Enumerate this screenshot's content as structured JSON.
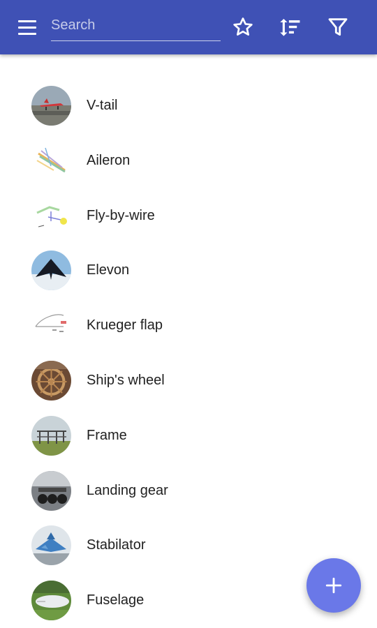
{
  "app_bar": {
    "background_color": "#3f51b5",
    "menu_icon": "hamburger-menu-icon",
    "search": {
      "placeholder": "Search",
      "value": ""
    },
    "actions": [
      {
        "icon": "star-outline-icon"
      },
      {
        "icon": "sort-icon"
      },
      {
        "icon": "filter-icon"
      }
    ]
  },
  "list": {
    "items": [
      {
        "label": "V-tail",
        "thumbnail": "red-aircraft-on-runway"
      },
      {
        "label": "Aileron",
        "thumbnail": "aileron-diagram"
      },
      {
        "label": "Fly-by-wire",
        "thumbnail": "fly-by-wire-diagram"
      },
      {
        "label": "Elevon",
        "thumbnail": "stealth-aircraft-in-sky"
      },
      {
        "label": "Krueger flap",
        "thumbnail": "krueger-flap-diagram"
      },
      {
        "label": "Ship's wheel",
        "thumbnail": "wooden-ships-wheel"
      },
      {
        "label": "Frame",
        "thumbnail": "airframe-on-grass"
      },
      {
        "label": "Landing gear",
        "thumbnail": "landing-gear-closeup"
      },
      {
        "label": "Stabilator",
        "thumbnail": "jet-fighter-blue-camouflage"
      },
      {
        "label": "Fuselage",
        "thumbnail": "white-fuselage-in-field"
      }
    ]
  },
  "fab": {
    "icon": "plus-icon",
    "color": "#6a78e8"
  }
}
